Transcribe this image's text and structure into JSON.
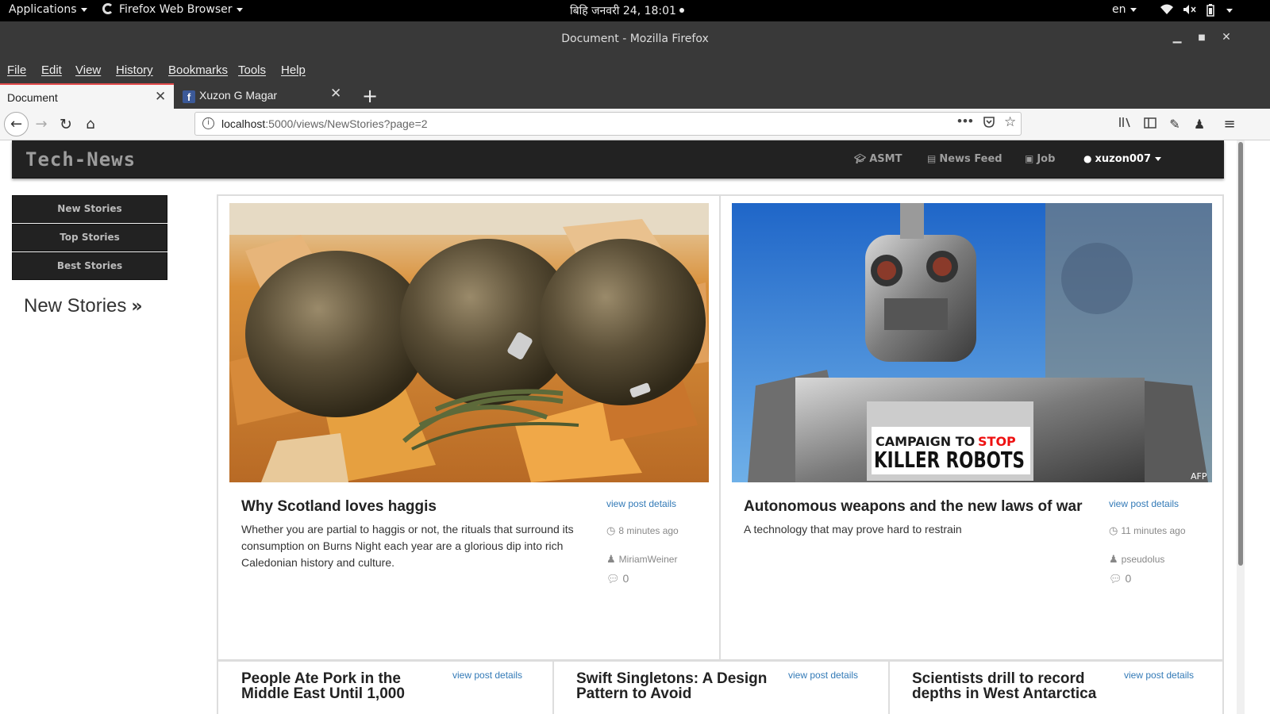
{
  "system": {
    "applications": "Applications",
    "browser_app": "Firefox Web Browser",
    "clock": "बिहि जनवरी 24, 18:01",
    "lang": "en"
  },
  "window": {
    "title": "Document - Mozilla Firefox"
  },
  "menu": [
    "File",
    "Edit",
    "View",
    "History",
    "Bookmarks",
    "Tools",
    "Help"
  ],
  "tabs": [
    {
      "label": "Document",
      "active": true
    },
    {
      "label": "Xuzon G Magar",
      "active": false
    }
  ],
  "url": {
    "host": "localhost",
    "rest": ":5000/views/NewStories?page=2"
  },
  "site": {
    "brand": "Tech-News",
    "nav": [
      {
        "label": "ASMT",
        "icon": "graduation-cap-icon"
      },
      {
        "label": "News Feed",
        "icon": "newspaper-icon"
      },
      {
        "label": "Job",
        "icon": "briefcase-icon"
      }
    ],
    "user": "xuzon007"
  },
  "sidebar": {
    "buttons": [
      "New Stories",
      "Top Stories",
      "Best Stories"
    ],
    "heading": "New Stories"
  },
  "stories": [
    {
      "title": "Why Scotland loves haggis",
      "desc": "Whether you are partial to haggis or not, the rituals that surround its consumption on Burns Night each year are a glorious dip into rich Caledonian history and culture.",
      "link": "view post details",
      "time": "8 minutes ago",
      "author": "MiriamWeiner",
      "comments": "0"
    },
    {
      "title": "Autonomous weapons and the new laws of war",
      "desc": "A technology that may prove hard to restrain",
      "link": "view post details",
      "time": "11 minutes ago",
      "author": "pseudolus",
      "comments": "0",
      "image_text": {
        "line1": "CAMPAIGN TO",
        "stop": "STOP",
        "line2": "KILLER ROBOTS",
        "credit": "AFP"
      }
    },
    {
      "title": "People Ate Pork in the Middle East Until 1,000",
      "link": "view post details"
    },
    {
      "title": "Swift Singletons: A Design Pattern to Avoid",
      "link": "view post details"
    },
    {
      "title": "Scientists drill to record depths in West Antarctica",
      "link": "view post details"
    }
  ]
}
